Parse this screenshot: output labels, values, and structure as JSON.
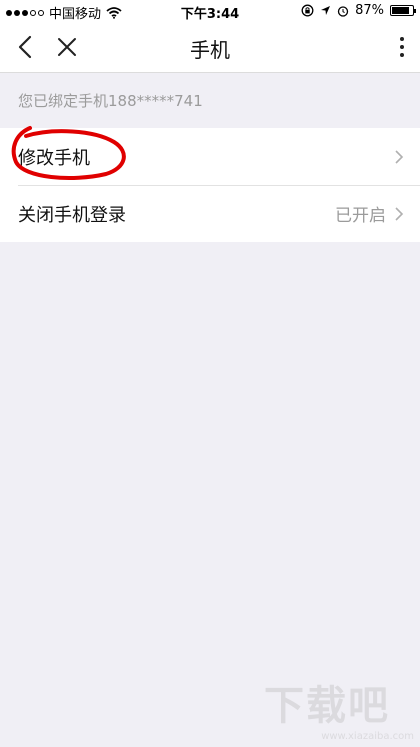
{
  "status_bar": {
    "carrier": "中国移动",
    "time": "下午3:44",
    "battery_percent": "87%",
    "battery_level": 0.87
  },
  "nav": {
    "title": "手机",
    "back_icon": "chevron-left-icon",
    "close_icon": "close-icon",
    "more_icon": "more-vertical-icon"
  },
  "bound_phone_hint": "您已绑定手机188*****741",
  "settings": {
    "items": [
      {
        "label": "修改手机",
        "value": ""
      },
      {
        "label": "关闭手机登录",
        "value": "已开启"
      }
    ]
  },
  "watermark": {
    "text": "下载吧",
    "url": "www.xiazaiba.com"
  },
  "colors": {
    "background": "#f0eff5",
    "annotation": "#e00000"
  }
}
